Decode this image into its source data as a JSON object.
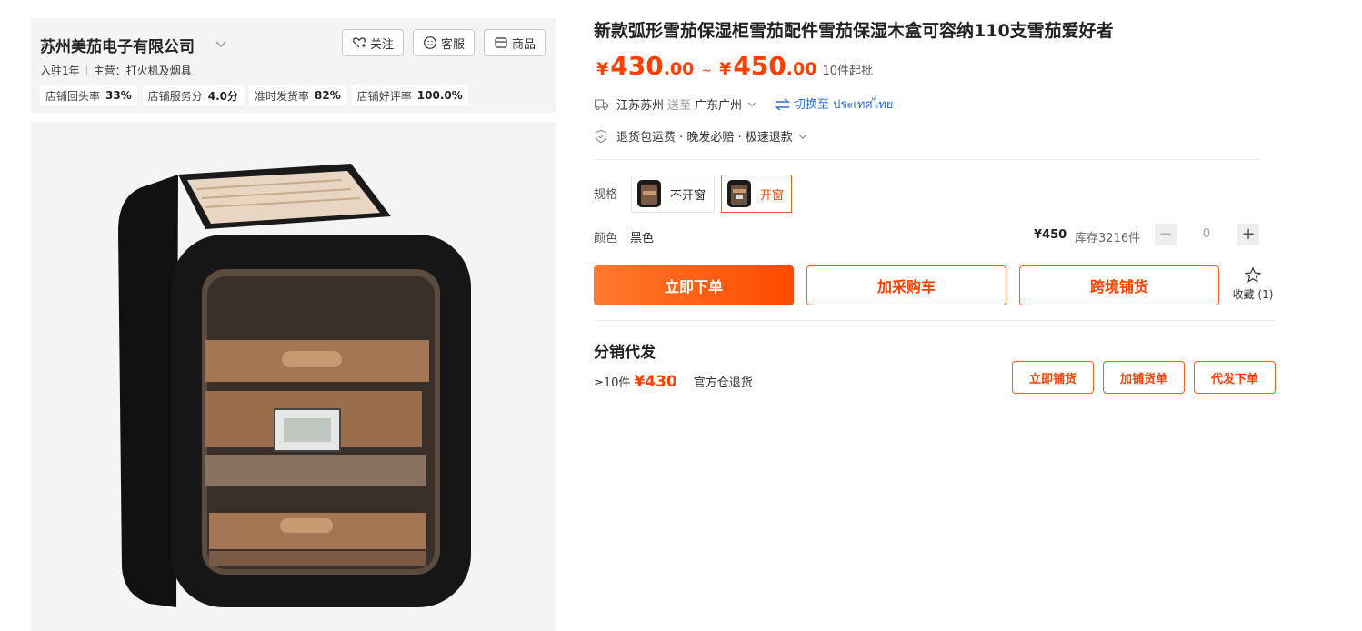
{
  "shop": {
    "name": "苏州美茄电子有限公司",
    "follow_label": "关注",
    "service_label": "客服",
    "goods_label": "商品",
    "settled": "入驻1年",
    "main_business": "主营：打火机及烟具",
    "stats": [
      {
        "label": "店铺回头率",
        "value": "33%"
      },
      {
        "label": "店铺服务分",
        "value": "4.0分"
      },
      {
        "label": "准时发货率",
        "value": "82%"
      },
      {
        "label": "店铺好评率",
        "value": "100.0%"
      }
    ]
  },
  "product": {
    "title": "新款弧形雪茄保湿柜雪茄配件雪茄保湿木盒可容纳110支雪茄爱好者",
    "price": {
      "currency": "¥",
      "low_int": "430",
      "low_dec": ".00",
      "separator": "~",
      "high_int": "450",
      "high_dec": ".00",
      "moq": "10件起批"
    },
    "shipping": {
      "from": "江苏苏州",
      "to_word": "送至",
      "to": "广东广州",
      "switch_label": "切换至 ประเทศไทย"
    },
    "services": "退货包运费 · 晚发必赔 · 极速退款",
    "spec_label": "规格",
    "spec_options": [
      {
        "label": "不开窗",
        "active": false
      },
      {
        "label": "开窗",
        "active": true
      }
    ],
    "color_label": "颜色",
    "color_value": "黑色",
    "unit_price": "¥450",
    "stock": "库存3216件",
    "quantity": "0",
    "qty_minus": "−",
    "qty_plus": "+"
  },
  "actions": {
    "buy_now": "立即下单",
    "add_cart": "加采购车",
    "cross_border": "跨境铺货",
    "favorite": "收藏 (1)"
  },
  "distribution": {
    "title": "分销代发",
    "moq": "≥10件",
    "price": "¥430",
    "return_note": "官方仓退货",
    "btn_list_now": "立即铺货",
    "btn_add_list": "加铺货单",
    "btn_dropship": "代发下单"
  },
  "colors": {
    "accent": "#ff4000",
    "link": "#2b6cd9",
    "panel": "#f4f4f4"
  }
}
